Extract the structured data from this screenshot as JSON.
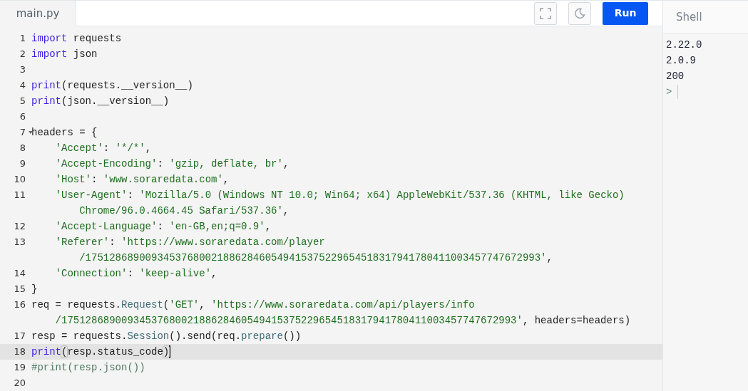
{
  "file_tab": {
    "label": "main.py",
    "selected": true
  },
  "toolbar": {
    "run_label": "Run"
  },
  "shell": {
    "title": "Shell",
    "output": [
      "2.22.0",
      "2.0.9",
      "200"
    ],
    "prompt": ">"
  },
  "code_lines": [
    {
      "number": "1",
      "active": false,
      "foldable": false,
      "indented": false,
      "tokens": [
        {
          "kind": "keyword",
          "text": "import"
        },
        {
          "kind": "plain",
          "text": " requests"
        }
      ]
    },
    {
      "number": "2",
      "active": false,
      "foldable": false,
      "indented": false,
      "tokens": [
        {
          "kind": "keyword",
          "text": "import"
        },
        {
          "kind": "plain",
          "text": " json"
        }
      ]
    },
    {
      "number": "3",
      "active": false,
      "foldable": false
    },
    {
      "number": "4",
      "active": false,
      "foldable": false,
      "indented": false,
      "tokens": [
        {
          "kind": "keyword",
          "text": "print"
        },
        {
          "kind": "plain",
          "text": "(requests.__version__)"
        }
      ]
    },
    {
      "number": "5",
      "active": false,
      "foldable": false,
      "indented": false,
      "tokens": [
        {
          "kind": "keyword",
          "text": "print"
        },
        {
          "kind": "plain",
          "text": "(json.__version__)"
        }
      ]
    },
    {
      "number": "6",
      "active": false,
      "foldable": false
    },
    {
      "number": "7",
      "active": false,
      "foldable": true,
      "indented": false,
      "tokens": [
        {
          "kind": "plain",
          "text": "headers = {"
        }
      ]
    },
    {
      "number": "8",
      "active": false,
      "foldable": false,
      "indented": true,
      "tokens": [
        {
          "kind": "string",
          "text": "'Accept'"
        },
        {
          "kind": "plain",
          "text": ": "
        },
        {
          "kind": "string",
          "text": "'*/*'"
        },
        {
          "kind": "plain",
          "text": ","
        }
      ]
    },
    {
      "number": "9",
      "active": false,
      "foldable": false,
      "indented": true,
      "tokens": [
        {
          "kind": "string",
          "text": "'Accept-Encoding'"
        },
        {
          "kind": "plain",
          "text": ": "
        },
        {
          "kind": "string",
          "text": "'gzip, deflate, br'"
        },
        {
          "kind": "plain",
          "text": ","
        }
      ]
    },
    {
      "number": "10",
      "active": false,
      "foldable": false,
      "indented": true,
      "tokens": [
        {
          "kind": "string",
          "text": "'Host'"
        },
        {
          "kind": "plain",
          "text": ": "
        },
        {
          "kind": "string",
          "text": "'www.soraredata.com'"
        },
        {
          "kind": "plain",
          "text": ","
        }
      ]
    },
    {
      "number": "11",
      "active": false,
      "foldable": false,
      "indented": true,
      "tokens": [
        {
          "kind": "string",
          "text": "'User-Agent'"
        },
        {
          "kind": "plain",
          "text": ": "
        },
        {
          "kind": "string",
          "text": "'Mozilla/5.0 (Windows NT 10.0; Win64; x64) AppleWebKit/537.36 (KHTML, like Gecko)"
        },
        {
          "kind": "wrap"
        },
        {
          "kind": "string",
          "text": "Chrome/96.0.4664.45 Safari/537.36'"
        },
        {
          "kind": "plain",
          "text": ","
        }
      ]
    },
    {
      "number": "12",
      "active": false,
      "foldable": false,
      "indented": true,
      "tokens": [
        {
          "kind": "string",
          "text": "'Accept-Language'"
        },
        {
          "kind": "plain",
          "text": ": "
        },
        {
          "kind": "string",
          "text": "'en-GB,en;q=0.9'"
        },
        {
          "kind": "plain",
          "text": ","
        }
      ]
    },
    {
      "number": "13",
      "active": false,
      "foldable": false,
      "indented": true,
      "tokens": [
        {
          "kind": "string",
          "text": "'Referer'"
        },
        {
          "kind": "plain",
          "text": ": "
        },
        {
          "kind": "string",
          "text": "'https://www.soraredata.com/player"
        },
        {
          "kind": "wrap"
        },
        {
          "kind": "string",
          "text": "/1751286890093453768002188628460549415375229654518317941780411003457747672993'"
        },
        {
          "kind": "plain",
          "text": ","
        }
      ]
    },
    {
      "number": "14",
      "active": false,
      "foldable": false,
      "indented": true,
      "tokens": [
        {
          "kind": "string",
          "text": "'Connection'"
        },
        {
          "kind": "plain",
          "text": ": "
        },
        {
          "kind": "string",
          "text": "'keep-alive'"
        },
        {
          "kind": "plain",
          "text": ","
        }
      ]
    },
    {
      "number": "15",
      "active": false,
      "foldable": false,
      "indented": false,
      "tokens": [
        {
          "kind": "plain",
          "text": "}"
        }
      ]
    },
    {
      "number": "16",
      "active": false,
      "foldable": false,
      "indented": false,
      "tokens": [
        {
          "kind": "plain",
          "text": "req = requests."
        },
        {
          "kind": "method",
          "text": "Request"
        },
        {
          "kind": "plain",
          "text": "("
        },
        {
          "kind": "string",
          "text": "'GET'"
        },
        {
          "kind": "plain",
          "text": ", "
        },
        {
          "kind": "string",
          "text": "'https://www.soraredata.com/api/players/info"
        },
        {
          "kind": "wrap"
        },
        {
          "kind": "string",
          "text": "/1751286890093453768002188628460549415375229654518317941780411003457747672993'"
        },
        {
          "kind": "plain",
          "text": ", headers=headers)"
        }
      ]
    },
    {
      "number": "17",
      "active": false,
      "foldable": false,
      "indented": false,
      "tokens": [
        {
          "kind": "plain",
          "text": "resp = requests."
        },
        {
          "kind": "method",
          "text": "Session"
        },
        {
          "kind": "plain",
          "text": "().send(req."
        },
        {
          "kind": "method",
          "text": "prepare"
        },
        {
          "kind": "plain",
          "text": "())"
        }
      ]
    },
    {
      "number": "18",
      "active": true,
      "foldable": false,
      "indented": false,
      "tokens": [
        {
          "kind": "keyword",
          "text": "print"
        },
        {
          "kind": "bracket",
          "text": "("
        },
        {
          "kind": "plain",
          "text": "resp.status_code"
        },
        {
          "kind": "bracket",
          "text": ")"
        }
      ]
    },
    {
      "number": "19",
      "active": false,
      "foldable": false,
      "indented": false,
      "tokens": [
        {
          "kind": "comment",
          "text": "#print(resp.json())"
        }
      ]
    },
    {
      "number": "20",
      "active": false,
      "foldable": false
    }
  ]
}
